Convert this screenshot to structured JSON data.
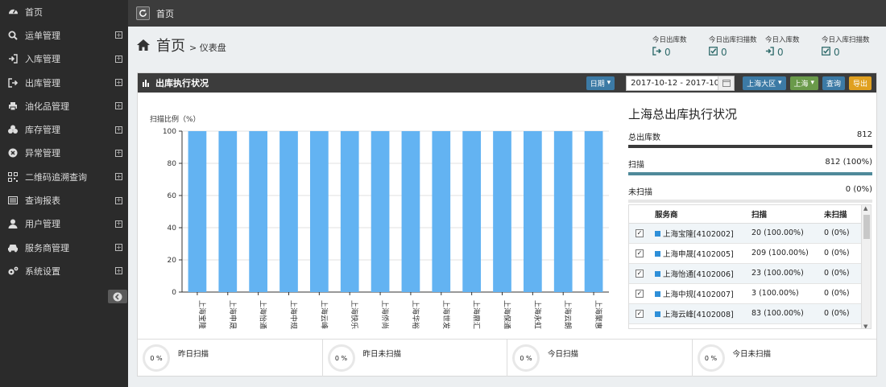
{
  "sidebar": {
    "items": [
      {
        "label": "首页",
        "icon": "dashboard-icon",
        "expandable": false
      },
      {
        "label": "运单管理",
        "icon": "search-icon",
        "expandable": true
      },
      {
        "label": "入库管理",
        "icon": "sign-in-icon",
        "expandable": true
      },
      {
        "label": "出库管理",
        "icon": "sign-out-icon",
        "expandable": true
      },
      {
        "label": "油化品管理",
        "icon": "print-icon",
        "expandable": true
      },
      {
        "label": "库存管理",
        "icon": "cubes-icon",
        "expandable": true
      },
      {
        "label": "异常管理",
        "icon": "times-circle-icon",
        "expandable": true
      },
      {
        "label": "二维码追溯查询",
        "icon": "qrcode-icon",
        "expandable": true
      },
      {
        "label": "查询报表",
        "icon": "list-alt-icon",
        "expandable": true
      },
      {
        "label": "用户管理",
        "icon": "user-icon",
        "expandable": true
      },
      {
        "label": "服务商管理",
        "icon": "car-icon",
        "expandable": true
      },
      {
        "label": "系统设置",
        "icon": "cogs-icon",
        "expandable": true
      }
    ],
    "plus_symbol": "⊞"
  },
  "topbar": {
    "breadcrumb": "首页"
  },
  "header": {
    "title": "首页",
    "subtitle": "> 仪表盘"
  },
  "stats": [
    {
      "label": "今日出库数",
      "value": "0",
      "icon": "sign-out-icon"
    },
    {
      "label": "今日出库扫描数",
      "value": "0",
      "icon": "check-square-icon"
    },
    {
      "label": "今日入库数",
      "value": "0",
      "icon": "sign-in-icon"
    },
    {
      "label": "今日入库扫描数",
      "value": "0",
      "icon": "check-square-icon"
    }
  ],
  "panel": {
    "title": "出库执行状况",
    "date_button": "日期",
    "date_range": "2017-10-12 - 2017-10",
    "region_button": "上海大区",
    "city_button": "上海",
    "query_button": "查询",
    "export_button": "导出"
  },
  "chart_data": {
    "type": "bar",
    "ylabel": "扫描比例（%）",
    "ylim": [
      0,
      100
    ],
    "yticks": [
      0,
      20,
      40,
      60,
      80,
      100
    ],
    "categories": [
      "上海宝隆",
      "上海申晟",
      "上海怡通",
      "上海中规",
      "上海云峰",
      "上海快乐",
      "上海侨尚",
      "上海华裕",
      "上海世发",
      "上海鼎汇",
      "上海保通",
      "上海永虹",
      "上海云朗",
      "上海聚惠"
    ],
    "values": [
      100,
      100,
      100,
      100,
      100,
      100,
      100,
      100,
      100,
      100,
      100,
      100,
      100,
      100
    ],
    "color": "#63b3f2"
  },
  "summary": {
    "title": "上海总出库执行状况",
    "rows": [
      {
        "label": "总出库数",
        "value": "812",
        "fraction": 1.0,
        "color": "#3a3a3a"
      },
      {
        "label": "扫描",
        "value": "812 (100%)",
        "fraction": 1.0,
        "color": "#4f8a9a"
      },
      {
        "label": "未扫描",
        "value": "0 (0%)",
        "fraction": 0.0,
        "color": "#4f8a9a"
      }
    ]
  },
  "table": {
    "headers": [
      "服务商",
      "扫描",
      "未扫描"
    ],
    "check_mark": "✓",
    "rows": [
      {
        "name": "上海宝隆[4102002]",
        "scan": "20 (100.00%)",
        "unscan": "0 (0%)"
      },
      {
        "name": "上海申晟[4102005]",
        "scan": "209 (100.00%)",
        "unscan": "0 (0%)"
      },
      {
        "name": "上海怡通[4102006]",
        "scan": "23 (100.00%)",
        "unscan": "0 (0%)"
      },
      {
        "name": "上海中规[4102007]",
        "scan": "3 (100.00%)",
        "unscan": "0 (0%)"
      },
      {
        "name": "上海云峰[4102008]",
        "scan": "83 (100.00%)",
        "unscan": "0 (0%)"
      }
    ]
  },
  "dials": [
    {
      "percent": "0 %",
      "label": "昨日扫描"
    },
    {
      "percent": "0 %",
      "label": "昨日未扫描"
    },
    {
      "percent": "0 %",
      "label": "今日扫描"
    },
    {
      "percent": "0 %",
      "label": "今日未扫描"
    }
  ]
}
